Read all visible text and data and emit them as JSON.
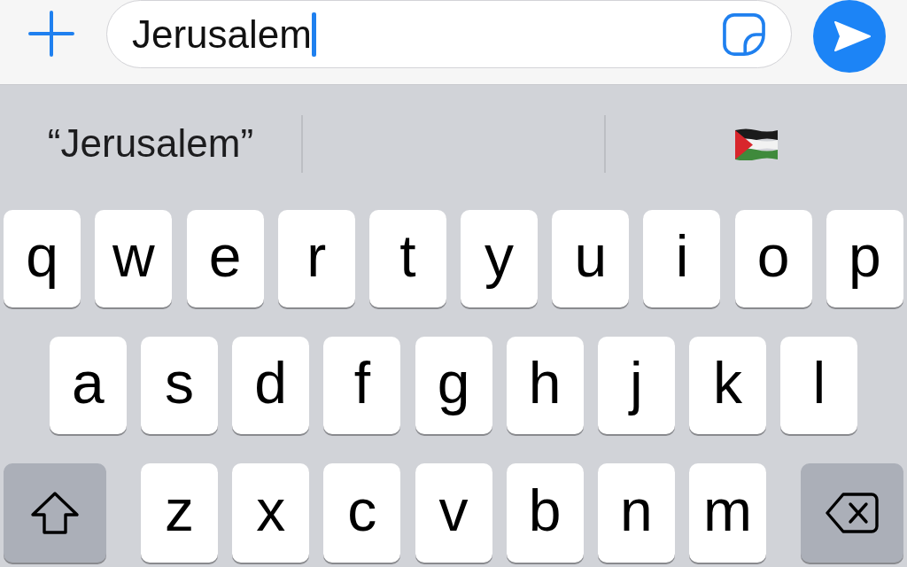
{
  "compose_bar": {
    "message_field": {
      "value": "Jerusalem",
      "focused": true
    }
  },
  "suggestions": [
    {
      "kind": "word",
      "text": "“Jerusalem”"
    },
    {
      "kind": "blank"
    },
    {
      "kind": "emoji"
    }
  ],
  "keyboard": {
    "rows": [
      {
        "keys": [
          {
            "kind": "letter",
            "label": "q"
          },
          {
            "kind": "letter",
            "label": "w"
          },
          {
            "kind": "letter",
            "label": "e"
          },
          {
            "kind": "letter",
            "label": "r"
          },
          {
            "kind": "letter",
            "label": "t"
          },
          {
            "kind": "letter",
            "label": "y"
          },
          {
            "kind": "letter",
            "label": "u"
          },
          {
            "kind": "letter",
            "label": "i"
          },
          {
            "kind": "letter",
            "label": "o"
          },
          {
            "kind": "letter",
            "label": "p"
          }
        ]
      },
      {
        "keys": [
          {
            "kind": "letter",
            "label": "a"
          },
          {
            "kind": "letter",
            "label": "s"
          },
          {
            "kind": "letter",
            "label": "d"
          },
          {
            "kind": "letter",
            "label": "f"
          },
          {
            "kind": "letter",
            "label": "g"
          },
          {
            "kind": "letter",
            "label": "h"
          },
          {
            "kind": "letter",
            "label": "j"
          },
          {
            "kind": "letter",
            "label": "k"
          },
          {
            "kind": "letter",
            "label": "l"
          }
        ]
      },
      {
        "keys": [
          {
            "kind": "shift"
          },
          {
            "kind": "letter",
            "label": "z"
          },
          {
            "kind": "letter",
            "label": "x"
          },
          {
            "kind": "letter",
            "label": "c"
          },
          {
            "kind": "letter",
            "label": "v"
          },
          {
            "kind": "letter",
            "label": "b"
          },
          {
            "kind": "letter",
            "label": "n"
          },
          {
            "kind": "letter",
            "label": "m"
          },
          {
            "kind": "backspace"
          }
        ]
      }
    ]
  }
}
